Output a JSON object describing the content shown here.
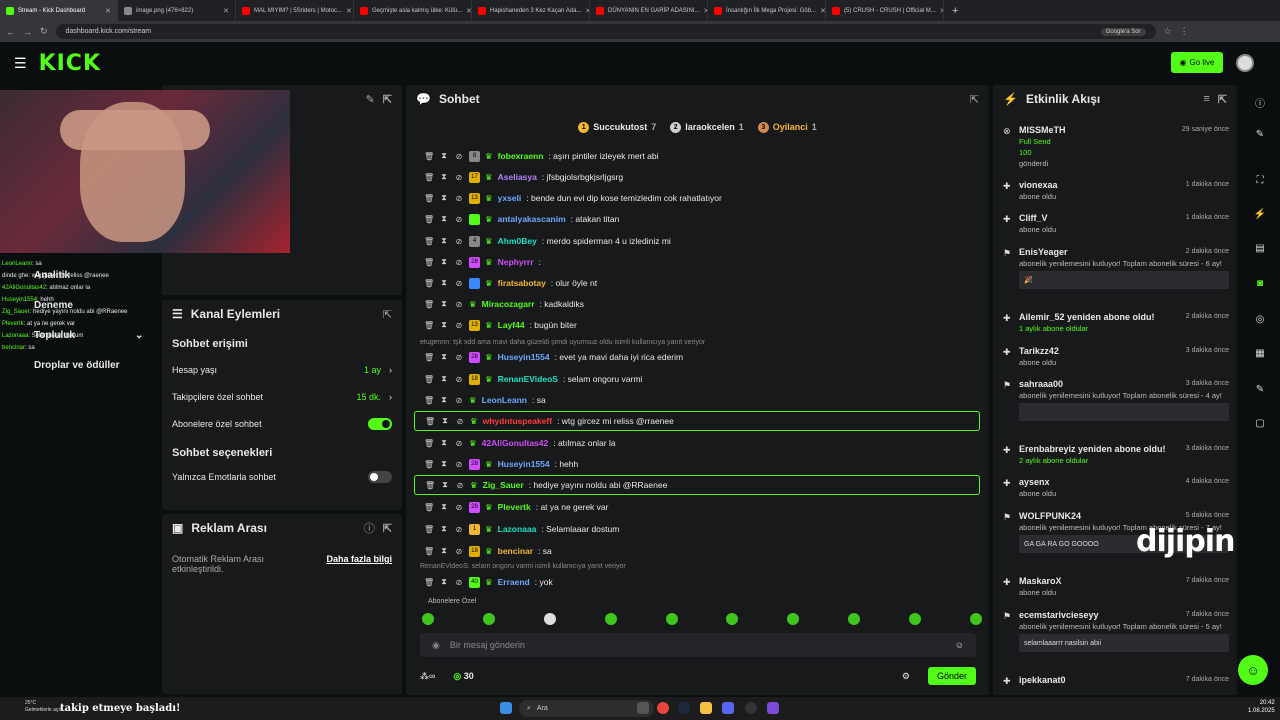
{
  "browser": {
    "tabs": [
      {
        "label": "Stream - Kick Dashboard",
        "color": "#53fc18",
        "active": true
      },
      {
        "label": "image.png (476×822)",
        "color": "#888888"
      },
      {
        "label": "MAL MIYIM? | 5Sriders | Motoc...",
        "color": "#ff0000"
      },
      {
        "label": "Geçmişte asla kalmış ülke: Külü...",
        "color": "#ff0000"
      },
      {
        "label": "Hapishaneden 3 Kez Kaçan Ada...",
        "color": "#ff0000"
      },
      {
        "label": "DÜNYANIN EN GARİP ADASINI...",
        "color": "#ff0000"
      },
      {
        "label": "İnsanlığın İlk Mega Projesi: Göb...",
        "color": "#ff0000"
      },
      {
        "label": "(5) CRUSH - CRUSH | Official M...",
        "color": "#ff0000"
      }
    ],
    "url": "dashboard.kick.com/stream",
    "google_button": "Google'a Sor"
  },
  "topnav": {
    "logo": "KICK",
    "go_live": "Go live"
  },
  "overlay_chat": [
    {
      "user": "LeonLeann",
      "text": ": sa"
    },
    {
      "user": "",
      "text": "dinde ghe: wtg gircez mi reliss @raenee"
    },
    {
      "user": "42AliGonultas42",
      "text": ": atılmaz onlar la"
    },
    {
      "user": "Huseyin1554",
      "text": ": hehh"
    },
    {
      "user": "Zig_Sauer",
      "text": ": hediye yayını noldu abi @RRaenee"
    },
    {
      "user": "Plevertk",
      "text": ": at ya ne gerek var"
    },
    {
      "user": "Lazonaaa",
      "text": ": Selamlaaar dostum"
    },
    {
      "user": "bencinar",
      "text": ": sa"
    }
  ],
  "left_labels": {
    "analytics": "Analitik",
    "trial": "Deneme",
    "community": "Topluluk",
    "drops": "Droplar ve ödüller"
  },
  "channel_actions": {
    "title": "Kanal Eylemleri",
    "chat_access_heading": "Sohbet erişimi",
    "account_age": {
      "label": "Hesap yaşı",
      "value": "1 ay"
    },
    "followers_only": {
      "label": "Takipçilere özel sohbet",
      "value": "15 dk."
    },
    "subscribers_only": {
      "label": "Abonelere özel sohbet",
      "on": true
    },
    "chat_options_heading": "Sohbet seçenekleri",
    "emotes_only": {
      "label": "Yalnızca Emotlarla sohbet",
      "on": false
    }
  },
  "ad_break": {
    "title": "Reklam Arası",
    "text": "Otomatik Reklam Arası etkinleştirildi.",
    "link": "Daha fazla bilgi"
  },
  "chat": {
    "title": "Sohbet",
    "podium": [
      {
        "rank": "1",
        "name": "Succukutost",
        "count": "7",
        "color": "#f2b632"
      },
      {
        "rank": "2",
        "name": "laraokcelen",
        "count": "1",
        "color": "#cfcfcf"
      },
      {
        "rank": "3",
        "name": "Oyilanci",
        "count": "1",
        "color": "#d38a4a"
      }
    ],
    "messages": [
      {
        "user": "fobexraenn",
        "text": ": aşırı pintiler izleyek mert abi",
        "color": "#53fc18",
        "badge": "#888888"
      },
      {
        "user": "Aseliasya",
        "text": ": jfsbgjolsrbgkjsrljgsrg",
        "color": "#b583ff",
        "badge": "#e0b000"
      },
      {
        "user": "yxseli",
        "text": ": bende dun evi dip kose temizledim cok rahatlatıyor",
        "color": "#6fa8ff",
        "badge": "#e0b000"
      },
      {
        "user": "antalyakascanim",
        "text": ": atakan titan",
        "color": "#6fa8ff",
        "badge": "#53fc18"
      },
      {
        "user": "Ahm0Bey",
        "text": ": merdo spiderman 4 u izlediniz mi",
        "color": "#19e0c7",
        "badge": "#888888"
      },
      {
        "user": "Nephyrrr",
        "text": ":",
        "color": "#d14bff",
        "badge": "#d14bff"
      },
      {
        "user": "firatsabotay",
        "text": ": olur öyle nt",
        "color": "#f2b632",
        "badge": "#3a88ff"
      },
      {
        "user": "Miracozagarr",
        "text": ": kadkaldiks",
        "color": "#53fc18",
        "badge": ""
      },
      {
        "user": "Layf44",
        "text": ": bugün biter",
        "color": "#53fc18",
        "badge": "#e0b000"
      },
      {
        "user": "Huseyin1554",
        "text": ": evet ya mavi daha iyi rica ederim",
        "color": "#6fa8ff",
        "badge": "#d14bff"
      },
      {
        "user": "RenanEVideoS",
        "text": ": selam ongoru varmi",
        "color": "#19e0c7",
        "badge": "#e0b000"
      },
      {
        "user": "LeonLeann",
        "text": ": sa",
        "color": "#6fa8ff",
        "badge": ""
      },
      {
        "user": "whydntuspeakeff",
        "text": ": wtg gircez mi reliss @rraenee",
        "color": "#ff3b3b",
        "badge": ""
      },
      {
        "user": "42AliGonultas42",
        "text": ": atılmaz onlar la",
        "color": "#d14bff",
        "badge": ""
      },
      {
        "user": "Huseyin1554",
        "text": ": hehh",
        "color": "#6fa8ff",
        "badge": "#d14bff"
      },
      {
        "user": "Zig_Sauer",
        "text": ": hediye yayını noldu abi @RRaenee",
        "color": "#53fc18",
        "badge": ""
      },
      {
        "user": "Plevertk",
        "text": ": at ya ne gerek var",
        "color": "#53fc18",
        "badge": "#d14bff"
      },
      {
        "user": "Lazonaaa",
        "text": ": Selamlaaar dostum",
        "color": "#19e0c7",
        "badge": "#f2b632"
      },
      {
        "user": "bencinar",
        "text": ": sa",
        "color": "#f2b632",
        "badge": "#e0b000"
      },
      {
        "user": "Erraend",
        "text": ": yok",
        "color": "#6fa8ff",
        "badge": "#53fc18"
      }
    ],
    "reply_1": "etugennn: tşk xdd ama mavi daha güzeldi şimdi uyumsuz oldu isimli kullanıcıya yanıt veriyor",
    "reply_2": "RenanEVideoS: selam ongoru varmi isimli kullanıcıya yanıt veriyor",
    "badge_numbers": [
      "8",
      "17",
      "13",
      "",
      "4",
      "28",
      "",
      "",
      "13",
      "28",
      "18",
      "",
      "",
      "",
      "28",
      "",
      "28",
      "1",
      "18",
      "40"
    ],
    "subscriber_emotes_label": "Abonelere Özel",
    "placeholder": "Bir mesaj gönderin",
    "points": "30",
    "send": "Gönder"
  },
  "activity": {
    "title": "Etkinlik Akışı",
    "items": [
      {
        "name": "MISSMeTH",
        "time": "29 saniye önce",
        "line1": "Full Send",
        "line2": "100",
        "line3": "gönderdi"
      },
      {
        "name": "vionexaa",
        "time": "1 dakika önce",
        "line1": "abone oldu"
      },
      {
        "name": "Cliff_V",
        "time": "1 dakika önce",
        "line1": "abone oldu"
      },
      {
        "name": "EnisYeager",
        "time": "2 dakika önce",
        "line1": "abonelik yenilemesini kutluyor! Toplam abonelik süresi - 6 ay!",
        "box": "🎉"
      },
      {
        "name": "Ailemir_52 yeniden abone oldu!",
        "time": "2 dakika önce",
        "line1": "1 aylık abone oldular"
      },
      {
        "name": "Tarikzz42",
        "time": "3 dakika önce",
        "line1": "abone oldu"
      },
      {
        "name": "sahraaa00",
        "time": "3 dakika önce",
        "line1": "abonelik yenilemesini kutluyor! Toplam abonelik süresi - 4 ay!",
        "box": ""
      },
      {
        "name": "Erenbabreyiz yeniden abone oldu!",
        "time": "3 dakika önce",
        "line1": "2 aylık abone oldular"
      },
      {
        "name": "aysenx",
        "time": "4 dakika önce",
        "line1": "abone oldu"
      },
      {
        "name": "WOLFPUNK24",
        "time": "5 dakika önce",
        "line1": "abonelik yenilemesini kutluyor! Toplam abonelik süresi - 7 ay!",
        "box": "GA GA RA GO GOOOO"
      },
      {
        "name": "MaskaroX",
        "time": "7 dakika önce",
        "line1": "abone oldu"
      },
      {
        "name": "ecemstarivcieseyy",
        "time": "7 dakika önce",
        "line1": "abonelik yenilemesini kutluyor! Toplam abonelik süresi - 5 ay!",
        "box": "selamlaaarrr nasilsin abii"
      },
      {
        "name": "ipekkanat0",
        "time": "7 dakika önce",
        "line1": ""
      }
    ]
  },
  "taskbar": {
    "follow_text": "takip etmeye başladı!",
    "search": "Ara",
    "time": "20:42",
    "date": "1.08.2025",
    "weather_temp": "25°C",
    "weather_text": "Gelmeklerle açık"
  },
  "watermark": "dijipin",
  "colors": {
    "accent": "#53fc18",
    "panel": "#18191b",
    "bg": "#0b0e0f"
  }
}
